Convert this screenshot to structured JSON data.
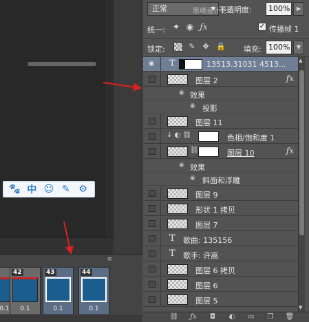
{
  "toolbar": {
    "blend_mode": "正常",
    "opacity_label": "不透明度:",
    "opacity_value": "100%",
    "unify_label": "统一:",
    "propagate_label": "传播帧 1",
    "lock_label": "锁定:",
    "fill_label": "填充:",
    "fill_value": "100%",
    "watermark": "思缘设计论坛"
  },
  "ime_bar": {
    "items": [
      "🐾",
      "中",
      "☺",
      "✎",
      "⚙"
    ]
  },
  "timeline": {
    "menu_icon": "≡",
    "frames": [
      {
        "num": "42",
        "delay": "0.1"
      },
      {
        "num": "43",
        "delay": "0.1"
      },
      {
        "num": "44",
        "delay": "0.1"
      }
    ],
    "first_delay": "0.1"
  },
  "layers": [
    {
      "type": "text",
      "name": "13513.31031 4513...",
      "selected": true
    },
    {
      "type": "pixel",
      "name": "图层 2",
      "fx": "fx"
    },
    {
      "type": "effects",
      "name": "效果"
    },
    {
      "type": "effect",
      "name": "投影"
    },
    {
      "type": "pixel",
      "name": "图层 11"
    },
    {
      "type": "adjust",
      "name": "色相/饱和度 1"
    },
    {
      "type": "pixelmask",
      "name": "图层 10",
      "fx": "fx"
    },
    {
      "type": "effects",
      "name": "效果"
    },
    {
      "type": "effect",
      "name": "斜面和浮雕"
    },
    {
      "type": "pixel",
      "name": "图层 9"
    },
    {
      "type": "pixel",
      "name": "形状 1 拷贝"
    },
    {
      "type": "pixel",
      "name": "图层 7"
    },
    {
      "type": "text",
      "name": "歌曲: 135156"
    },
    {
      "type": "text",
      "name": "歌手: 许嵩"
    },
    {
      "type": "pixel",
      "name": "图层 6 拷贝"
    },
    {
      "type": "pixel",
      "name": "图层 6"
    },
    {
      "type": "pixel",
      "name": "图层 5"
    }
  ],
  "bottom_bar": {
    "icons": [
      "link-icon",
      "fx-icon",
      "mask-icon",
      "adjustment-icon",
      "group-icon",
      "new-layer-icon",
      "delete-icon"
    ]
  }
}
